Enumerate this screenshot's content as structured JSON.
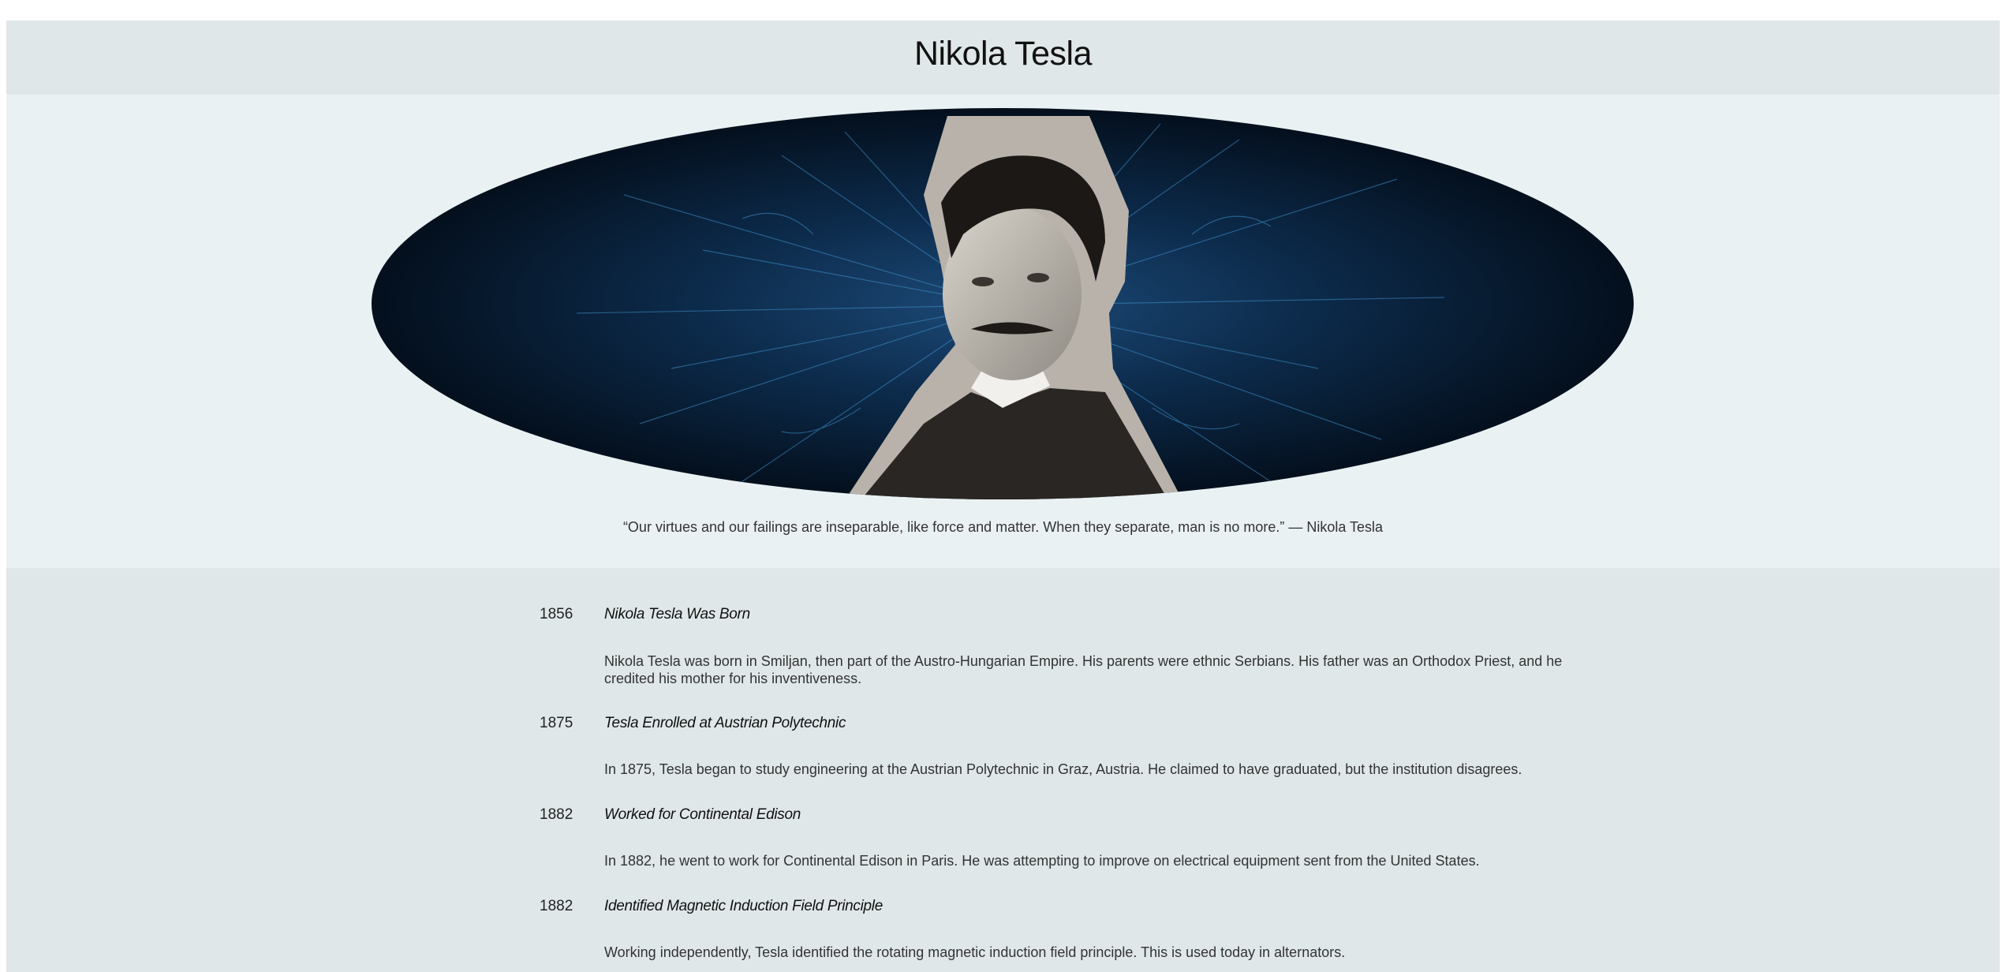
{
  "header": {
    "title": "Nikola Tesla"
  },
  "hero": {
    "image_alt": "Portrait of Nikola Tesla",
    "quote": "“Our virtues and our failings are inseparable, like force and matter. When they separate, man is no more.” — Nikola Tesla"
  },
  "timeline": [
    {
      "year": "1856",
      "title": "Nikola Tesla Was Born",
      "body": "Nikola Tesla was born in Smiljan, then part of the Austro-Hungarian Empire. His parents were ethnic Serbians. His father was an Orthodox Priest, and he credited his mother for his inventiveness."
    },
    {
      "year": "1875",
      "title": "Tesla Enrolled at Austrian Polytechnic",
      "body": "In 1875, Tesla began to study engineering at the Austrian Polytechnic in Graz, Austria. He claimed to have graduated, but the institution disagrees."
    },
    {
      "year": "1882",
      "title": "Worked for Continental Edison",
      "body": "In 1882, he went to work for Continental Edison in Paris. He was attempting to improve on electrical equipment sent from the United States."
    },
    {
      "year": "1882",
      "title": "Identified Magnetic Induction Field Principle",
      "body": "Working independently, Tesla identified the rotating magnetic induction field principle. This is used today in alternators."
    }
  ]
}
